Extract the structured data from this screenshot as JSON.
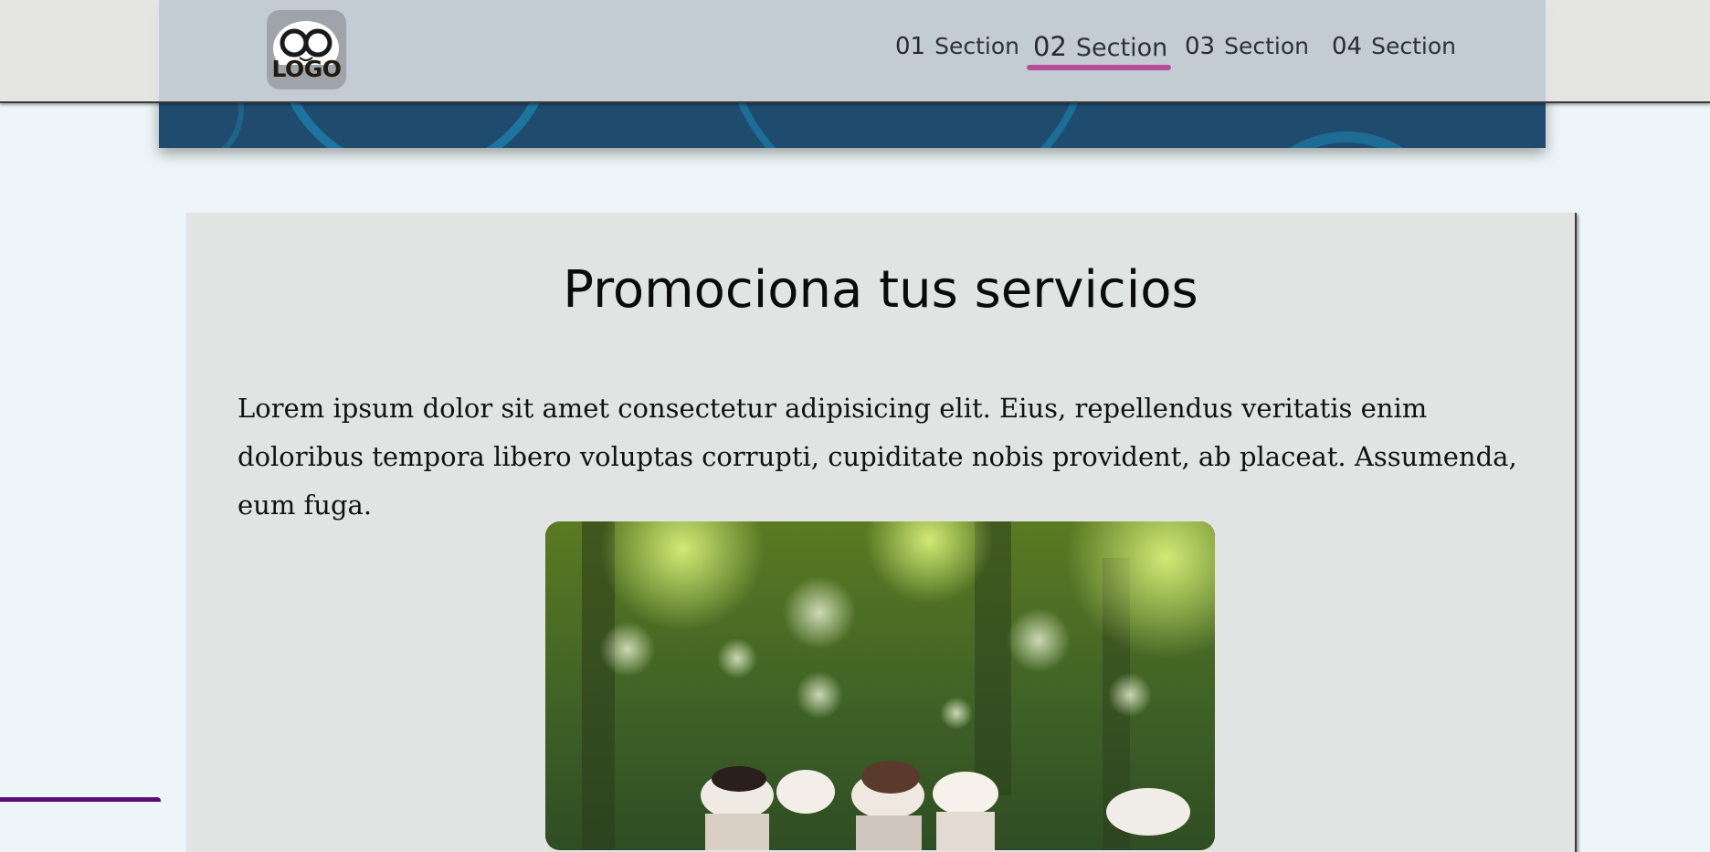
{
  "header": {
    "logo_text": "LOGO",
    "nav": [
      {
        "num": "01",
        "label": "Section",
        "active": false
      },
      {
        "num": "02",
        "label": "Section",
        "active": true
      },
      {
        "num": "03",
        "label": "Section",
        "active": false
      },
      {
        "num": "04",
        "label": "Section",
        "active": false
      }
    ]
  },
  "main": {
    "title": "Promociona tus servicios",
    "paragraph": "Lorem ipsum dolor sit amet consectetur adipisicing elit. Eius, repellendus veritatis enim doloribus tempora libero voluptas corrupti, cupiditate nobis provident, ab placeat. Assumenda, eum fuga.",
    "image_subject": "cupcakes-in-forest-photo"
  },
  "colors": {
    "accent_underline": "#b84e9b",
    "hero_blue": "#1f4b6e",
    "card_bg": "#e2e4e3",
    "page_bg": "#edf5f8",
    "corner_tab": "#5a0f78"
  }
}
